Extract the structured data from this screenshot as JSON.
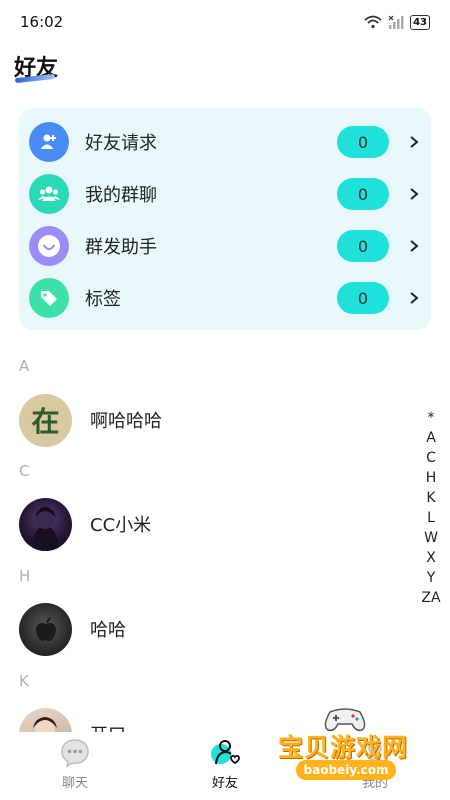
{
  "status_bar": {
    "time": "16:02",
    "battery": "43"
  },
  "header": {
    "title": "好友"
  },
  "functions": [
    {
      "label": "好友请求",
      "count": "0",
      "icon": "friend-request-icon",
      "color": "#4a8cf5"
    },
    {
      "label": "我的群聊",
      "count": "0",
      "icon": "group-chat-icon",
      "color": "#2bd9b7"
    },
    {
      "label": "群发助手",
      "count": "0",
      "icon": "broadcast-icon",
      "color": "#9c8cf7"
    },
    {
      "label": "标签",
      "count": "0",
      "icon": "tag-icon",
      "color": "#3de0a7"
    }
  ],
  "sections": [
    {
      "letter": "A",
      "contacts": [
        {
          "name": "啊哈哈哈",
          "avatar_char": "在"
        }
      ]
    },
    {
      "letter": "C",
      "contacts": [
        {
          "name": "CC小米"
        }
      ]
    },
    {
      "letter": "H",
      "contacts": [
        {
          "name": "哈哈"
        }
      ]
    },
    {
      "letter": "K",
      "contacts": [
        {
          "name": "开口"
        }
      ]
    }
  ],
  "index_bar": [
    "*",
    "A",
    "C",
    "H",
    "K",
    "L",
    "W",
    "X",
    "Y",
    "ZA"
  ],
  "bottom_nav": [
    {
      "label": "聊天",
      "active": false
    },
    {
      "label": "好友",
      "active": true
    },
    {
      "label": "我的",
      "active": false
    }
  ],
  "watermark": {
    "text": "宝贝游戏网",
    "url": "baobeiy.com"
  },
  "colors": {
    "accent": "#1fe0da",
    "card_bg": "#e9f8fb",
    "section_letter": "#b0b0b0"
  }
}
